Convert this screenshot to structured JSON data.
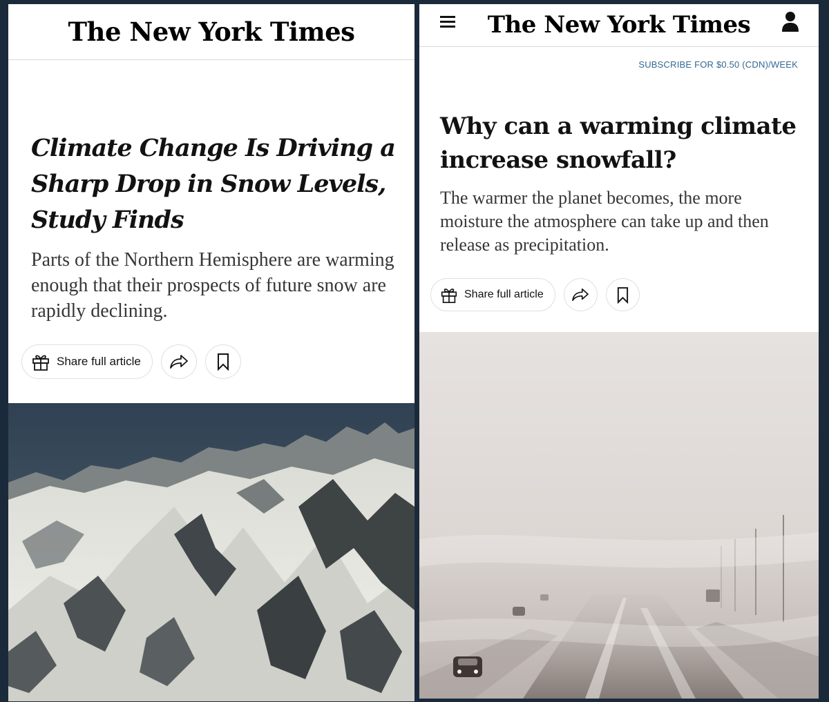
{
  "left_article": {
    "masthead": "The New York Times",
    "headline": "Climate Change Is Driving a Sharp Drop in Snow Levels, Study Finds",
    "summary": "Parts of the Northern Hemisphere are warming enough that their prospects of future snow are rapidly declining.",
    "share_label": "Share full article",
    "photo_icon": "mountain-photo"
  },
  "right_article": {
    "masthead": "The New York Times",
    "subscribe_text": "SUBSCRIBE FOR $0.50 (CDN)/WEEK",
    "headline": "Why can a warming climate increase snowfall?",
    "summary": "The warmer the planet becomes, the more moisture the atmosphere can take up and then release as precipitation.",
    "share_label": "Share full article",
    "photo_icon": "blizzard-road-photo"
  },
  "icons": {
    "menu": "hamburger-menu-icon",
    "account": "user-icon",
    "gift": "gift-icon",
    "share": "share-arrow-icon",
    "save": "bookmark-icon"
  },
  "colors": {
    "background": "#1b2a3a",
    "link": "#326891",
    "headline": "#121212",
    "summary": "#363636"
  }
}
